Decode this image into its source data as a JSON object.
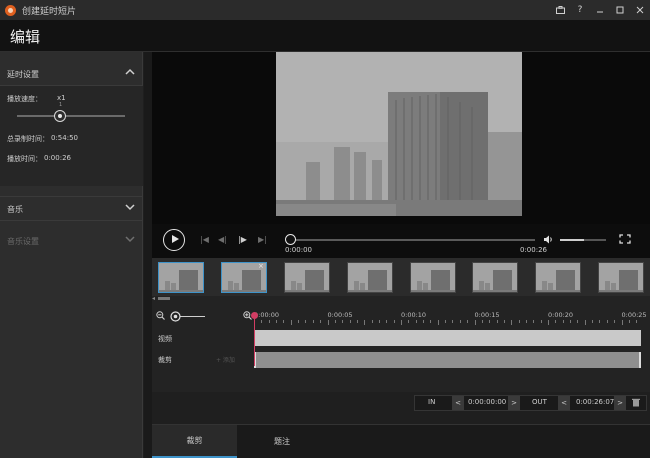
{
  "window": {
    "title": "创建延时短片",
    "controls": [
      "toolbox-icon",
      "help-icon",
      "minimize-icon",
      "maximize-icon",
      "close-icon"
    ],
    "help_label": "?"
  },
  "header": {
    "title": "编辑"
  },
  "sidebar": {
    "timelapse": {
      "title": "延时设置",
      "speed_label": "播放速度：",
      "speed_value": "x1",
      "slider_tick": "1",
      "speed_level": 0.4,
      "total_label": "总录制时间：",
      "total_value": "0:54:50",
      "play_label": "播放时间：",
      "play_value": "0:00:26"
    },
    "music": {
      "title": "音乐"
    },
    "music_settings": {
      "title": "音乐设置",
      "enabled": false
    }
  },
  "player": {
    "current_time": "0:00:00",
    "end_time": "0:00:26",
    "position": 0.0,
    "volume": 0.52
  },
  "thumbnails": {
    "count": 8,
    "selected": [
      0,
      1
    ],
    "close_label": "×"
  },
  "timeline": {
    "ruler_labels": [
      "0:00:00",
      "0:00:05",
      "0:00:10",
      "0:00:15",
      "0:00:20",
      "0:00:25"
    ],
    "tracks": {
      "video": "视频",
      "clip": "裁剪"
    },
    "clip_inline": "+ 添加"
  },
  "inout": {
    "in_label": "IN",
    "in_time": "0:00:00:00",
    "out_label": "OUT",
    "out_time": "0:00:26:07"
  },
  "tabs": [
    {
      "label": "裁剪",
      "active": true
    },
    {
      "label": "题注",
      "active": false
    }
  ],
  "colors": {
    "accent": "#3e93c9",
    "playhead": "#d23d63",
    "app_icon": "#e0601f"
  }
}
